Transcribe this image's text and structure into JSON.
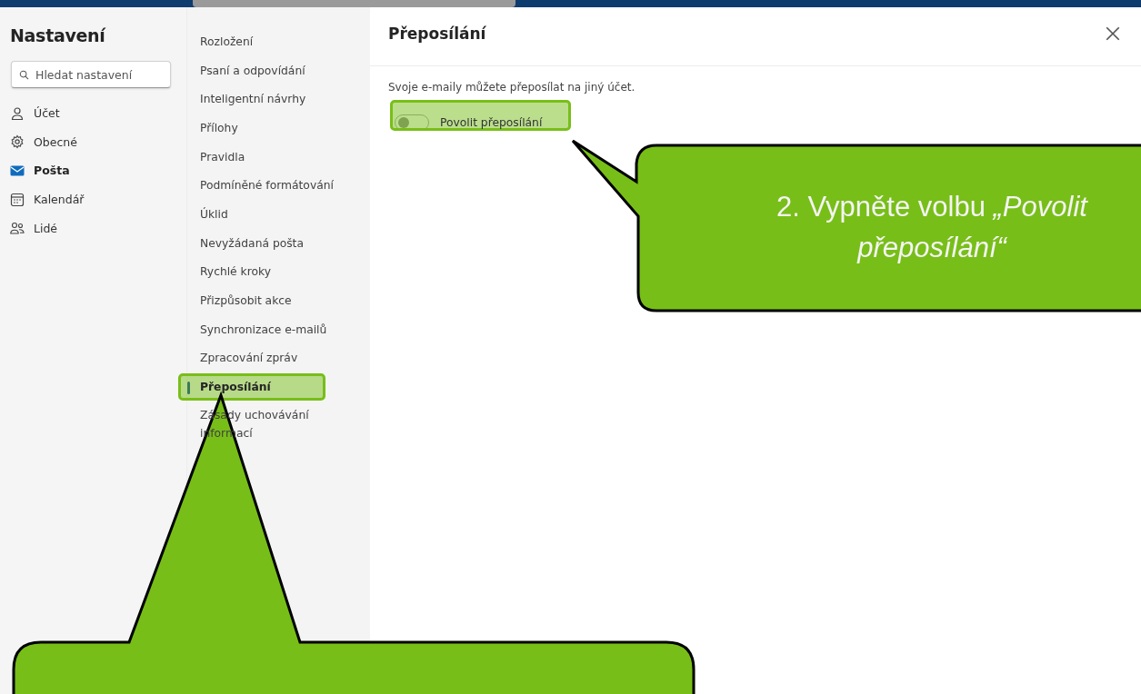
{
  "window": {
    "title": "Nastavení"
  },
  "search": {
    "placeholder": "Hledat nastavení"
  },
  "sidebar": {
    "items": [
      {
        "label": "Účet",
        "selected": false
      },
      {
        "label": "Obecné",
        "selected": false
      },
      {
        "label": "Pošta",
        "selected": true
      },
      {
        "label": "Kalendář",
        "selected": false
      },
      {
        "label": "Lidé",
        "selected": false
      }
    ]
  },
  "categories": [
    {
      "label": "Rozložení",
      "selected": false,
      "highlighted": false
    },
    {
      "label": "Psaní a odpovídání",
      "selected": false,
      "highlighted": false
    },
    {
      "label": "Inteligentní návrhy",
      "selected": false,
      "highlighted": false
    },
    {
      "label": "Přílohy",
      "selected": false,
      "highlighted": false
    },
    {
      "label": "Pravidla",
      "selected": false,
      "highlighted": false
    },
    {
      "label": "Podmíněné formátování",
      "selected": false,
      "highlighted": false
    },
    {
      "label": "Úklid",
      "selected": false,
      "highlighted": false
    },
    {
      "label": "Nevyžádaná pošta",
      "selected": false,
      "highlighted": false
    },
    {
      "label": "Rychlé kroky",
      "selected": false,
      "highlighted": false
    },
    {
      "label": "Přizpůsobit akce",
      "selected": false,
      "highlighted": false
    },
    {
      "label": "Synchronizace e-mailů",
      "selected": false,
      "highlighted": false
    },
    {
      "label": "Zpracování zpráv",
      "selected": false,
      "highlighted": false
    },
    {
      "label": "Přeposílání",
      "selected": true,
      "highlighted": true
    },
    {
      "label": "Zásady uchovávání informací",
      "selected": false,
      "highlighted": false
    }
  ],
  "panel": {
    "title": "Přeposílání",
    "description": "Svoje e-maily můžete přeposílat na jiný účet.",
    "toggle": {
      "label": "Povolit přeposílání",
      "on": false,
      "highlighted": true
    }
  },
  "callouts": [
    {
      "kind": "side-pointer",
      "text": "2. Vypněte volbu *„Povolit přeposílání“*"
    },
    {
      "kind": "up-pointer"
    }
  ]
}
